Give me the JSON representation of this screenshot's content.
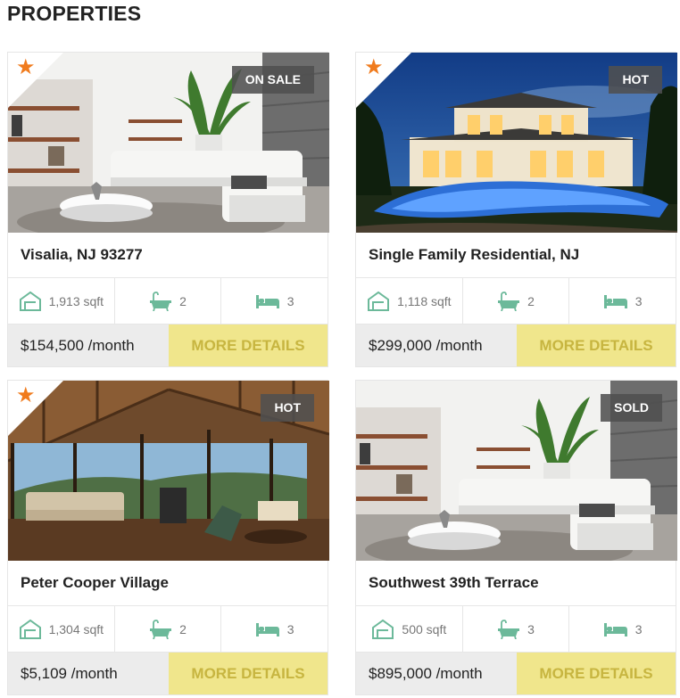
{
  "section": {
    "title": "PROPERTIES"
  },
  "colors": {
    "accent_star": "#f07b1d",
    "more_details_bg": "#f0e68c",
    "more_details_text": "#c7b540",
    "icon_green": "#6cb99a"
  },
  "icons": {
    "area": "house-outline-icon",
    "bath": "bathtub-icon",
    "bed": "bed-icon",
    "featured": "star-icon"
  },
  "properties": [
    {
      "badge": "ON SALE",
      "title": "Visalia, NJ 93277",
      "area": "1,913 sqft",
      "baths": "2",
      "beds": "3",
      "price": "$154,500 /month",
      "cta": "MORE DETAILS",
      "image": "modern-living-room"
    },
    {
      "badge": "HOT",
      "title": "Single Family Residential, NJ",
      "area": "1,118 sqft",
      "baths": "2",
      "beds": "3",
      "price": "$299,000 /month",
      "cta": "MORE DETAILS",
      "image": "mansion-pool-night"
    },
    {
      "badge": "HOT",
      "title": "Peter Cooper Village",
      "area": "1,304 sqft",
      "baths": "2",
      "beds": "3",
      "price": "$5,109 /month",
      "cta": "MORE DETAILS",
      "image": "wooden-lodge-interior"
    },
    {
      "badge": "SOLD",
      "title": "Southwest 39th Terrace",
      "area": "500 sqft",
      "baths": "3",
      "beds": "3",
      "price": "$895,000 /month",
      "cta": "MORE DETAILS",
      "image": "modern-living-room"
    }
  ]
}
